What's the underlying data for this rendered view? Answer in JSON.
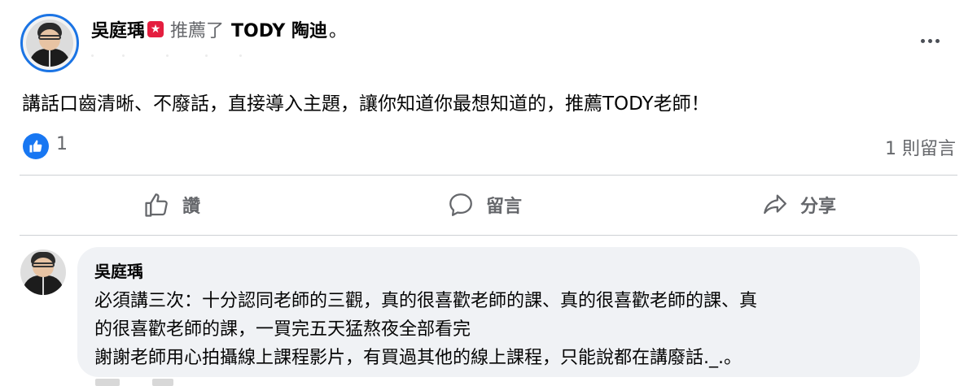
{
  "post": {
    "author": "吳庭瑀",
    "badge_glyph": "★",
    "recommend_text": "推薦了",
    "page_name": "TODY 陶迪",
    "period": "。",
    "body": "講話口齒清晰、不廢話，直接導入主題，讓你知道你最想知道的，推薦TODY老師！"
  },
  "reactions": {
    "like_count": "1",
    "comment_count": "1 則留言"
  },
  "actions": {
    "like": "讚",
    "comment": "留言",
    "share": "分享"
  },
  "comment": {
    "author": "吳庭瑀",
    "lines": [
      "必須講三次：十分認同老師的三觀，真的很喜歡老師的課、真的很喜歡老師的課、真",
      "的很喜歡老師的課，一買完五天猛熬夜全部看完",
      "謝謝老師用心拍攝線上課程影片，有買過其他的線上課程，只能說都在講廢話._.。"
    ]
  },
  "icons": {
    "more": "more-horizontal-icon",
    "like_reaction": "like-reaction-icon",
    "like_action": "thumbs-up-icon",
    "comment_action": "speech-bubble-icon",
    "share_action": "share-arrow-icon",
    "badge": "recommendation-star-icon"
  },
  "colors": {
    "accent": "#1877f2",
    "badge": "#e41e3f",
    "muted_text": "#65676b",
    "bubble": "#f0f2f5"
  }
}
